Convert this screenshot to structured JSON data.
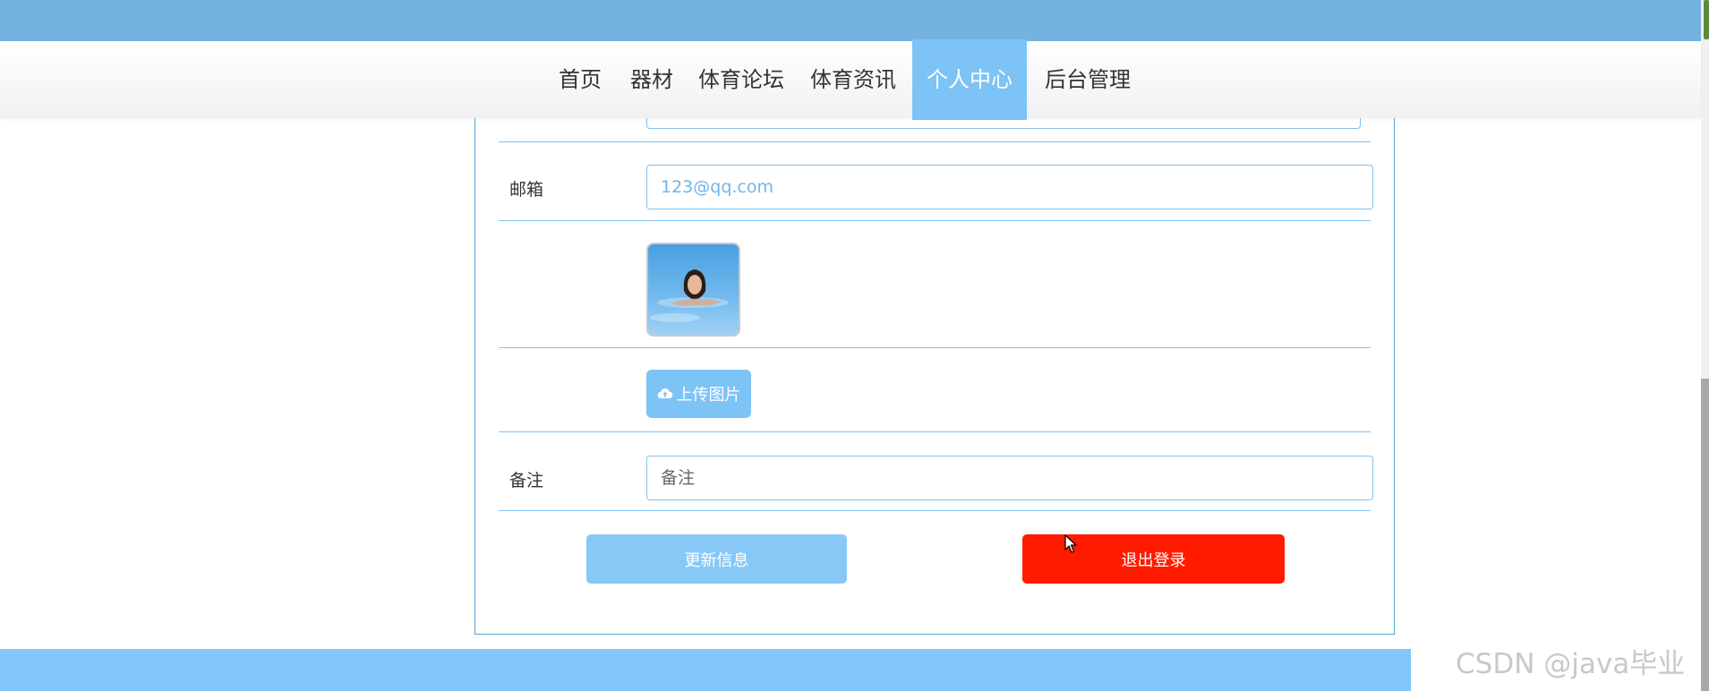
{
  "nav": {
    "items": [
      {
        "label": "首页"
      },
      {
        "label": "器材"
      },
      {
        "label": "体育论坛"
      },
      {
        "label": "体育资讯"
      },
      {
        "label": "个人中心"
      },
      {
        "label": "后台管理"
      }
    ],
    "active": "个人中心"
  },
  "form": {
    "email_label": "邮箱",
    "email_value": "123@qq.com",
    "avatar_alt": "avatar",
    "upload_label": "上传图片",
    "remark_label": "备注",
    "remark_placeholder": "备注",
    "update_label": "更新信息",
    "logout_label": "退出登录"
  },
  "colors": {
    "accent": "#7ec3f5",
    "logout": "#ff1b00",
    "top_band": "#74b3e0"
  },
  "icons": {
    "upload": "cloud-upload-icon",
    "cursor": "mouse-pointer-icon"
  },
  "watermark": "CSDN @java毕业"
}
